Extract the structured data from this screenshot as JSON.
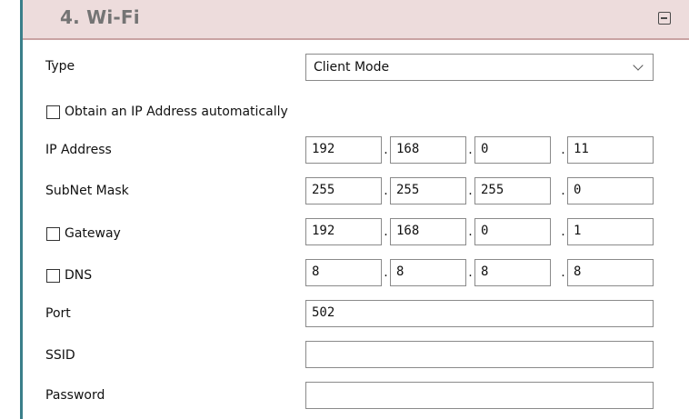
{
  "section": {
    "title": "4. Wi-Fi"
  },
  "type": {
    "label": "Type",
    "value": "Client Mode"
  },
  "dhcp": {
    "label": "Obtain an IP Address automatically",
    "checked": false
  },
  "ip_address": {
    "label": "IP Address",
    "octets": [
      "192",
      "168",
      "0",
      "11"
    ]
  },
  "subnet_mask": {
    "label": "SubNet Mask",
    "octets": [
      "255",
      "255",
      "255",
      "0"
    ]
  },
  "gateway": {
    "label": "Gateway",
    "checked": false,
    "octets": [
      "192",
      "168",
      "0",
      "1"
    ]
  },
  "dns": {
    "label": "DNS",
    "checked": false,
    "octets": [
      "8",
      "8",
      "8",
      "8"
    ]
  },
  "port": {
    "label": "Port",
    "value": "502"
  },
  "ssid": {
    "label": "SSID",
    "value": ""
  },
  "password": {
    "label": "Password",
    "value": ""
  },
  "colors": {
    "header_bg": "#eddcdc",
    "accent_border": "#3a7f8a"
  },
  "icons": {
    "collapse": "collapse-minus-icon",
    "dropdown": "chevron-down-icon"
  }
}
